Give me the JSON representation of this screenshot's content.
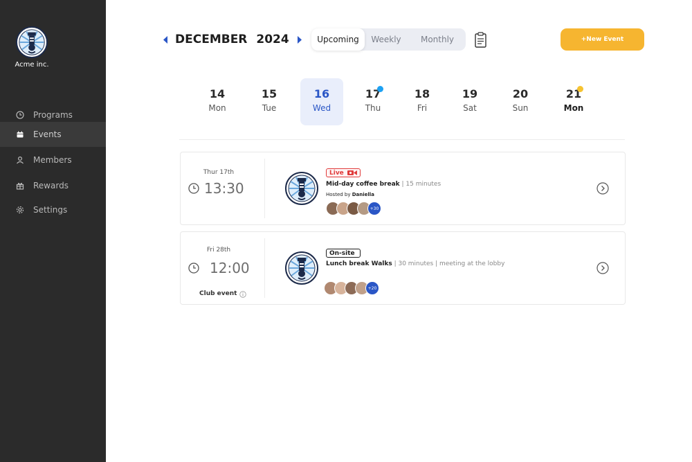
{
  "brand": {
    "name": "Acme inc."
  },
  "sidebar": {
    "items": [
      {
        "label": "Programs",
        "icon": "clock-icon",
        "active": false
      },
      {
        "label": "Events",
        "icon": "calendar-icon",
        "active": true
      },
      {
        "label": "Members",
        "icon": "user-icon",
        "active": false
      },
      {
        "label": "Rewards",
        "icon": "gift-icon",
        "active": false
      },
      {
        "label": "Settings",
        "icon": "gear-icon",
        "active": false
      }
    ]
  },
  "header": {
    "month": "DECEMBER",
    "year": "2024",
    "tabs": [
      "Upcoming",
      "Weekly",
      "Monthly"
    ],
    "active_tab": "Upcoming",
    "new_event_label": "+New Event"
  },
  "days": [
    {
      "num": "14",
      "wd": "Mon"
    },
    {
      "num": "15",
      "wd": "Tue"
    },
    {
      "num": "16",
      "wd": "Wed",
      "selected": true
    },
    {
      "num": "17",
      "wd": "Thu",
      "dot": "#1da1f2"
    },
    {
      "num": "18",
      "wd": "Fri"
    },
    {
      "num": "19",
      "wd": "Sat"
    },
    {
      "num": "20",
      "wd": "Sun"
    },
    {
      "num": "21",
      "wd": "Mon",
      "dot": "#f6c330"
    }
  ],
  "events": [
    {
      "date": "Thur 17th",
      "time": "13:30",
      "tag": "Live",
      "title": "Mid-day coffee break",
      "details": " | 15 minutes",
      "host_prefix": "Hosted by ",
      "host": "Daniella",
      "more": "+30"
    },
    {
      "date": "Fri 28th",
      "time": "12:00",
      "tag": "On-site",
      "title": "Lunch break Walks",
      "details": " | 30 minutes | meeting at the lobby",
      "footer": "Club event",
      "more": "+20"
    }
  ],
  "colors": {
    "sidebar_bg": "#2b2b2b",
    "accent_blue": "#2a56c6",
    "accent_orange": "#f6b530",
    "live_red": "#e03b3b"
  }
}
